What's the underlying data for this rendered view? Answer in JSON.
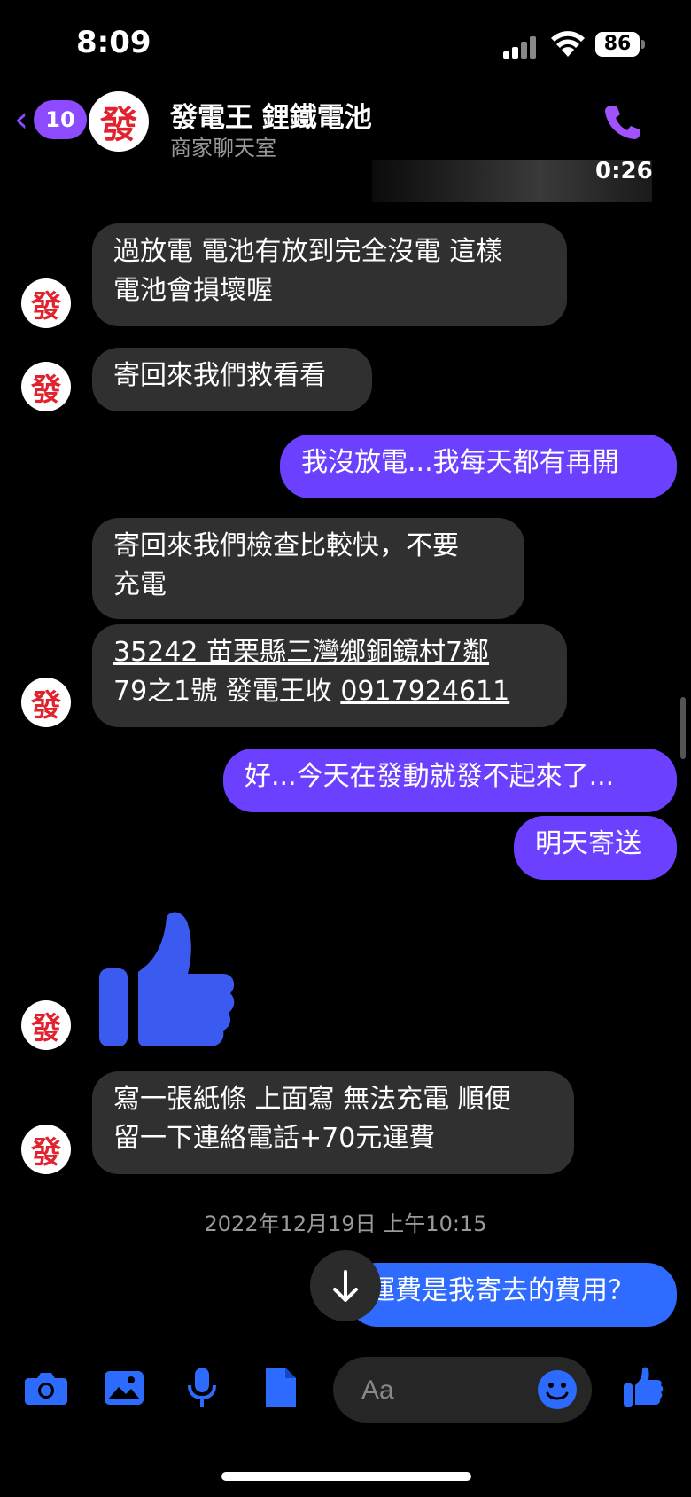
{
  "status_bar": {
    "time": "8:09",
    "battery": "86"
  },
  "header": {
    "back_count": "10",
    "avatar_char": "發",
    "title": "發電王 鋰鐵電池",
    "subtitle": "商家聊天室",
    "video_time": "0:26"
  },
  "messages": [
    {
      "dir": "in",
      "text_lines": [
        "過放電 電池有放到完全沒電 這樣",
        "電池會損壞喔"
      ]
    },
    {
      "dir": "in",
      "text_lines": [
        "寄回來我們救看看"
      ]
    },
    {
      "dir": "out",
      "text_lines": [
        "我沒放電...我每天都有再開"
      ]
    },
    {
      "dir": "in",
      "text_lines": [
        "寄回來我們檢查比較快，不要",
        "充電"
      ]
    },
    {
      "dir": "in",
      "address_line1": "35242 苗栗縣三灣鄉銅鏡村7鄰",
      "address_line2a": "79之1號 發電王收 ",
      "phone": "0917924611"
    },
    {
      "dir": "out",
      "text_lines": [
        "好...今天在發動就發不起來了..."
      ]
    },
    {
      "dir": "out",
      "text_lines": [
        "明天寄送"
      ]
    },
    {
      "dir": "in",
      "type": "like-sticker"
    },
    {
      "dir": "in",
      "text_lines": [
        "寫一張紙條 上面寫 無法充電 順便",
        "留一下連絡電話+70元運費"
      ]
    },
    {
      "dir": "out",
      "text_lines": [
        "運費是我寄去的費用？"
      ]
    }
  ],
  "date_separator": "2022年12月19日 上午10:15",
  "composer": {
    "placeholder": "Aa"
  },
  "colors": {
    "accent": "#8c4bff",
    "outgoing_bubble": "#6b40ff",
    "incoming_bubble": "#303030",
    "icon_blue": "#2d6bff"
  },
  "icons": [
    "camera-icon",
    "image-icon",
    "microphone-icon",
    "document-icon",
    "emoji-icon",
    "thumbs-up-icon",
    "phone-icon",
    "arrow-down-icon"
  ]
}
